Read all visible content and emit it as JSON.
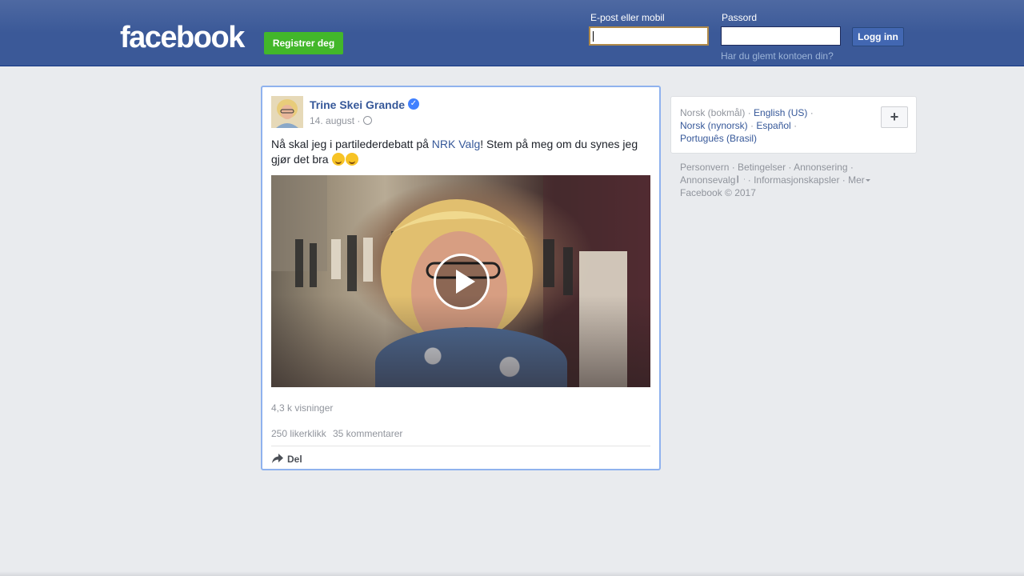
{
  "header": {
    "logo": "facebook",
    "register_label": "Registrer deg",
    "email_label": "E-post eller mobil",
    "email_value": "",
    "password_label": "Passord",
    "password_value": "",
    "login_label": "Logg inn",
    "forgot_label": "Har du glemt kontoen din?",
    "colors": {
      "bar": "#3b5998",
      "register": "#42b72a",
      "login": "#4267b2"
    }
  },
  "post": {
    "author": "Trine Skei Grande",
    "verified_icon": "verified-badge-icon",
    "date": "14. august ·",
    "audience_icon": "globe-icon",
    "text_before": "Nå skal jeg i partilederdebatt på ",
    "link_text": "NRK Valg",
    "text_after": "! Stem på meg om du synes jeg gjør det bra ",
    "emojis": [
      "smiling-face-icon",
      "grinning-face-icon"
    ],
    "video_icon": "play-icon",
    "views": "4,3 k visninger",
    "likes": "250 likerklikk",
    "comments": "35 kommentarer",
    "share_label": "Del"
  },
  "sidebar": {
    "current_language": "Norsk (bokmål)",
    "languages": [
      "English (US)",
      "Norsk (nynorsk)",
      "Español",
      "Português (Brasil)"
    ],
    "more_languages": "+",
    "footer_links": [
      "Personvern",
      "Betingelser",
      "Annonsering",
      "Annonsevalg",
      "Informasjonskapsler",
      "Mer"
    ],
    "copyright": "Facebook © 2017"
  }
}
